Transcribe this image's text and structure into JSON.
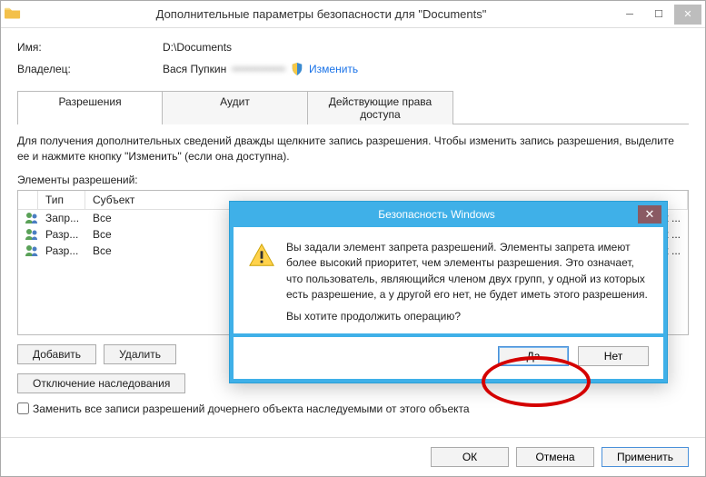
{
  "window": {
    "title": "Дополнительные параметры безопасности  для \"Documents\""
  },
  "info": {
    "name_label": "Имя:",
    "name_value": "D:\\Documents",
    "owner_label": "Владелец:",
    "owner_value": "Вася Пупкин",
    "owner_blur": "••••••••••••••",
    "change_link": "Изменить"
  },
  "tabs": {
    "perm": "Разрешения",
    "audit": "Аудит",
    "effective": "Действующие права доступа"
  },
  "panel": {
    "helptext": "Для получения дополнительных сведений дважды щелкните запись разрешения. Чтобы изменить запись разрешения, выделите ее и нажмите кнопку \"Изменить\" (если она доступна).",
    "elements_label": "Элементы разрешений:",
    "columns": {
      "type": "Тип",
      "subject": "Субъект"
    },
    "rows": [
      {
        "type": "Запр...",
        "subject": "Все",
        "tail": "к ..."
      },
      {
        "type": "Разр...",
        "subject": "Все",
        "tail": "к ..."
      },
      {
        "type": "Разр...",
        "subject": "Все",
        "tail": "к ..."
      }
    ],
    "add_btn": "Добавить",
    "remove_btn": "Удалить",
    "disable_inherit_btn": "Отключение наследования",
    "replace_checkbox": "Заменить все записи разрешений дочернего объекта наследуемыми от этого объекта"
  },
  "footer": {
    "ok": "ОК",
    "cancel": "Отмена",
    "apply": "Применить"
  },
  "modal": {
    "title": "Безопасность Windows",
    "text": "Вы задали элемент запрета разрешений. Элементы запрета имеют более высокий приоритет, чем элементы разрешения. Это означает, что пользователь, являющийся членом двух групп, у одной из которых есть разрешение, а у другой его нет, не будет иметь этого разрешения.",
    "question": "Вы хотите продолжить операцию?",
    "yes": "Да",
    "no": "Нет"
  }
}
